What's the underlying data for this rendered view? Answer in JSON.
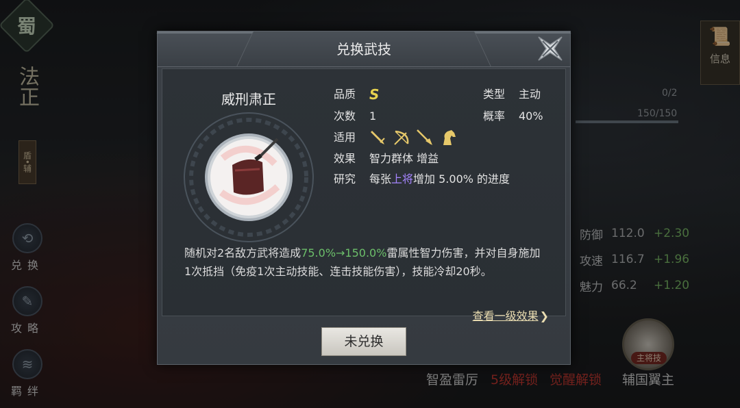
{
  "background": {
    "faction_char": "蜀",
    "hero_name": "法正",
    "hero_role": "盾•辅",
    "rail_buttons": [
      {
        "label": "兑换",
        "icon": "exchange-icon"
      },
      {
        "label": "攻略",
        "icon": "guide-icon"
      },
      {
        "label": "羁绊",
        "icon": "bond-icon"
      }
    ],
    "info_label": "信息",
    "bars": {
      "top": "0/2",
      "bottom": "150/150"
    },
    "stats": [
      {
        "name": "防御",
        "value": "112.0",
        "inc": "+2.30"
      },
      {
        "name": "攻速",
        "value": "116.7",
        "inc": "+1.96"
      },
      {
        "name": "魅力",
        "value": "66.2",
        "inc": "+1.20"
      }
    ],
    "skills": [
      {
        "label": "智盈雷厉",
        "color": "#d0d0d0"
      },
      {
        "label": "5级解锁",
        "color": "#c83a32"
      },
      {
        "label": "觉醒解锁",
        "color": "#c83a32"
      },
      {
        "label": "辅国翼主",
        "color": "#d0d0d0"
      }
    ],
    "skill_tag": "主将技"
  },
  "modal": {
    "title": "兑换武技",
    "skill_name": "威刑肃正",
    "quality_label": "品质",
    "quality_value": "S",
    "type_label": "类型",
    "type_value": "主动",
    "count_label": "次数",
    "count_value": "1",
    "rate_label": "概率",
    "rate_value": "40%",
    "applies_label": "适用",
    "applies_icons": [
      "sword-icon",
      "bow-icon",
      "spear-icon",
      "horse-icon"
    ],
    "effect_label": "效果",
    "effect_value": "智力群体 增益",
    "research_label": "研究",
    "research_prefix": "每张",
    "research_highlight": "上将",
    "research_suffix": "增加 5.00% 的进度",
    "description": {
      "part1": "随机对2名敌方武将造成",
      "highlight": "75.0%→150.0%",
      "part2": "雷属性智力伤害，并对自身施加1次抵挡（免疫1次主动技能、连击技能伤害），技能冷却20秒。"
    },
    "view_link": "查看一级效果",
    "footer_button": "未兑换"
  },
  "colors": {
    "quality": "#e7d24f",
    "highlight_purple": "#a685ff",
    "highlight_green": "#6cbf6a",
    "locked_red": "#c83a32"
  }
}
